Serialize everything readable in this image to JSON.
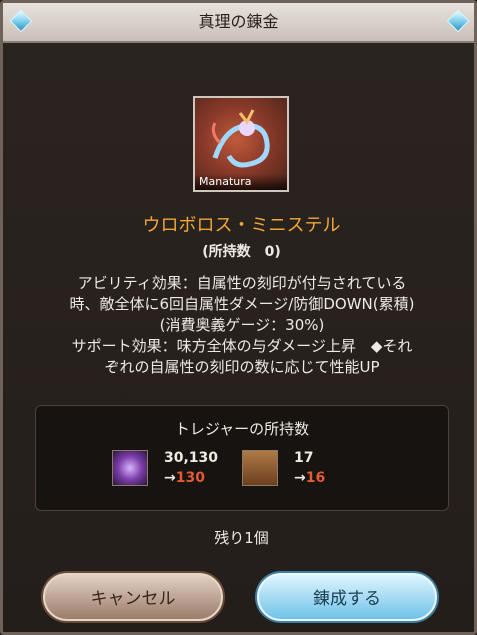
{
  "dialog": {
    "title": "真理の錬金",
    "summon": {
      "label": "Manatura",
      "name": "ウロボロス・ミニステル",
      "owned": "(所持数　0)"
    },
    "description": {
      "line1": "アビリティ効果：自属性の刻印が付与されている",
      "line2": "時、敵全体に6回自属性ダメージ/防御DOWN(累積)",
      "line3": "(消費奥義ゲージ：30%)",
      "line4": "サポート効果：味方全体の与ダメージ上昇　◆それ",
      "line5": "ぞれの自属性の刻印の数に応じて性能UP"
    },
    "treasure": {
      "title": "トレジャーの所持数",
      "items": [
        {
          "icon": "crystal-orb-icon",
          "current": "30,130",
          "arrow": "→",
          "next": "130"
        },
        {
          "icon": "hourglass-icon",
          "current": "17",
          "arrow": "→",
          "next": "16"
        }
      ]
    },
    "remaining": "残り1個",
    "buttons": {
      "cancel": "キャンセル",
      "confirm": "錬成する"
    }
  },
  "background": {
    "text": "ウロボロス・ミニステル"
  },
  "colors": {
    "accent": "#f0a63a",
    "next_value": "#e35a34",
    "confirm": "#6fc2e8"
  }
}
